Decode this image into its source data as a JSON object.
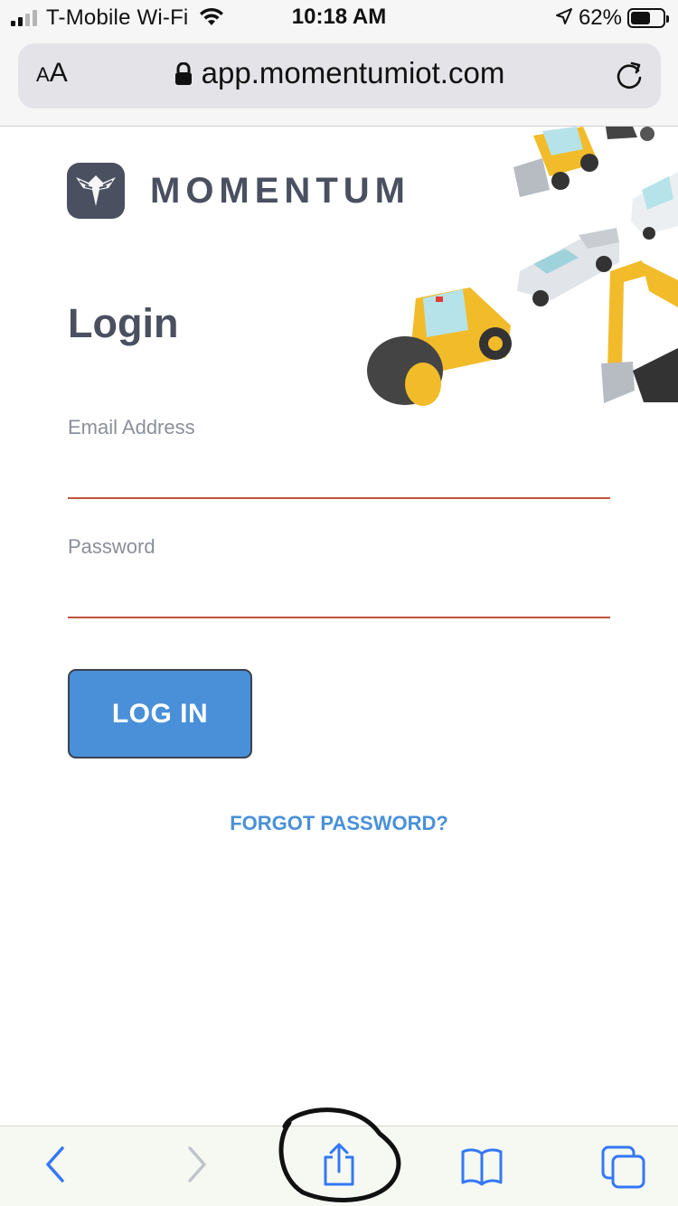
{
  "status_bar": {
    "carrier": "T-Mobile Wi-Fi",
    "time": "10:18 AM",
    "battery_percent": "62%",
    "battery_level": 0.62,
    "signal_bars_active": 2,
    "signal_bars_total": 4
  },
  "address_bar": {
    "text_size_label": "AA",
    "url": "app.momentumiot.com"
  },
  "page": {
    "brand_name": "MOMENTUM",
    "login_title": "Login",
    "email_label": "Email Address",
    "email_value": "",
    "password_label": "Password",
    "password_value": "",
    "login_button": "LOG IN",
    "forgot_password": "FORGOT PASSWORD?"
  },
  "toolbar": {
    "buttons": [
      "back-icon",
      "forward-icon",
      "share-icon",
      "bookmarks-icon",
      "tabs-icon"
    ],
    "share_highlighted": true
  },
  "colors": {
    "brand_gray": "#4a5060",
    "accent_blue": "#4a90d9",
    "input_underline": "#c0533e",
    "ios_blue": "#3478f6"
  }
}
